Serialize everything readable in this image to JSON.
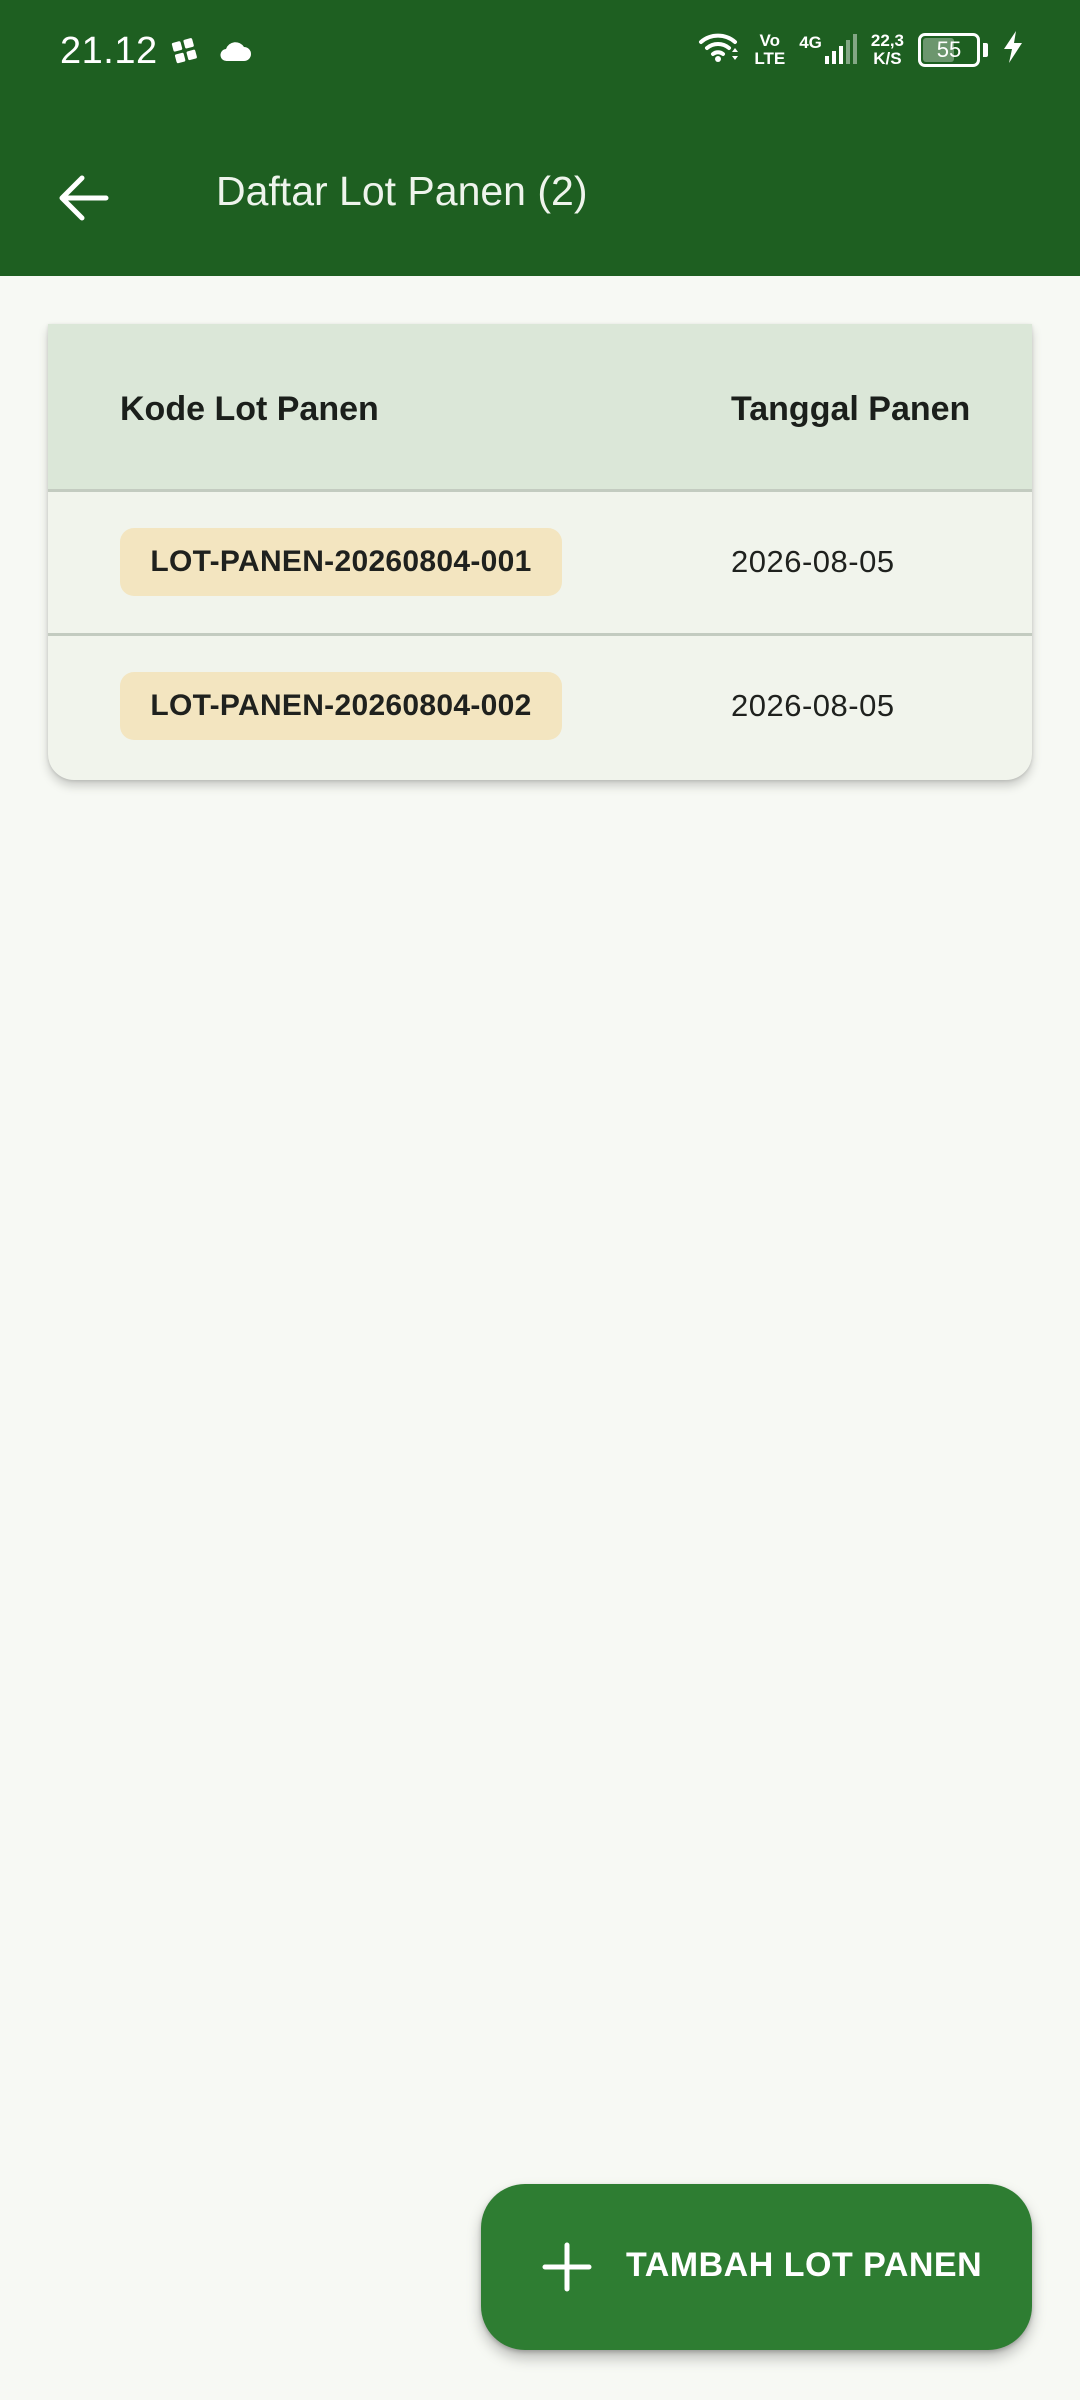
{
  "status_bar": {
    "time": "21.12",
    "volte_top": "Vo",
    "volte_bottom": "LTE",
    "network": "4G",
    "speed_value": "22,3",
    "speed_unit": "K/S",
    "battery_level": "55",
    "icons": [
      "app-notification-icon",
      "cloud-icon",
      "wifi-icon",
      "signal-icon",
      "battery-icon",
      "charging-icon"
    ]
  },
  "app_bar": {
    "title": "Daftar Lot Panen (2)",
    "back_icon": "arrow-back-icon"
  },
  "table": {
    "columns": [
      "Kode Lot Panen",
      "Tanggal Panen"
    ],
    "rows": [
      {
        "code": "LOT-PANEN-20260804-001",
        "date": "2026-08-05"
      },
      {
        "code": "LOT-PANEN-20260804-002",
        "date": "2026-08-05"
      }
    ]
  },
  "fab": {
    "label": "TAMBAH LOT PANEN",
    "icon": "plus-icon"
  },
  "colors": {
    "primary": "#1e5f21",
    "fab": "#2e7d32",
    "header_bg": "#dbe7d8",
    "row_bg": "#f1f4ec",
    "chip_bg": "#f3e5c0",
    "page_bg": "#f7f9f4"
  }
}
